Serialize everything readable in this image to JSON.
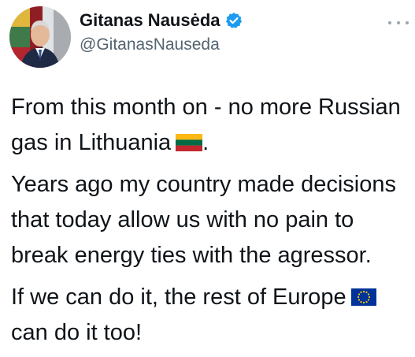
{
  "author": {
    "display_name": "Gitanas Nausėda",
    "handle": "@GitanasNauseda",
    "verified_icon": "verified-badge-icon"
  },
  "menu": {
    "icon": "more-options-icon"
  },
  "tweet": {
    "paragraph_1": "From this month on - no more Russian gas in Lithuania",
    "paragraph_1_end": ".",
    "paragraph_2": "Years ago my country made decisions that today allow us with no pain to break energy ties with the agressor.",
    "paragraph_3": "If we can do it, the rest of Europe",
    "paragraph_3_end": "can do it too!"
  },
  "emoji": {
    "lithuania": "flag-lithuania-icon",
    "eu": "flag-eu-icon"
  },
  "colors": {
    "text": "#0f1419",
    "secondary_text": "#536471",
    "verified_blue": "#1d9bf0",
    "lt_yellow": "#fdb913",
    "lt_green": "#006a44",
    "lt_red": "#c1272d",
    "eu_blue": "#003399",
    "eu_star": "#ffcc00"
  }
}
